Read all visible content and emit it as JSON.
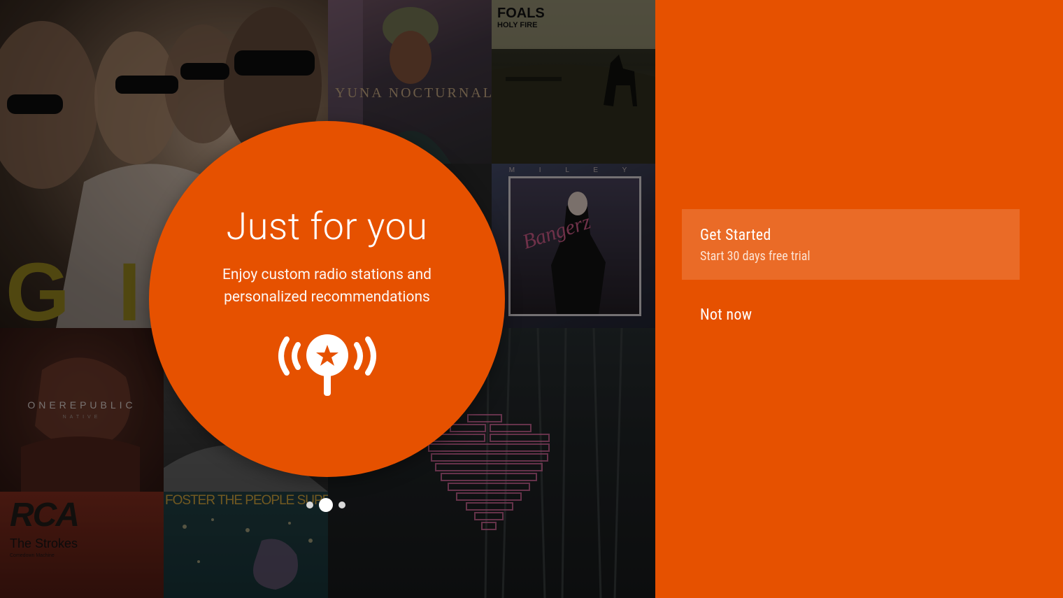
{
  "background": {
    "albums": [
      {
        "id": "pharrell",
        "text": "G I"
      },
      {
        "id": "yuna",
        "text": "YUNA NOCTURNAL"
      },
      {
        "id": "foals",
        "line1": "FOALS",
        "line2": "HOLY FIRE"
      },
      {
        "id": "miley",
        "top_text": "M I L E Y",
        "art_text": "Bangerz"
      },
      {
        "id": "onerepublic",
        "title": "ONEREPUBLIC",
        "subtitle": "NATIVE"
      },
      {
        "id": "rca",
        "label": "RCA",
        "artist": "The Strokes",
        "album": "Comedown Machine"
      },
      {
        "id": "foster",
        "text": "FOSTER THE PEOPLE SUPERMODEL"
      }
    ]
  },
  "promo": {
    "title": "Just for you",
    "description": "Enjoy custom radio stations and personalized recommendations",
    "icon": "radio-station-star-icon",
    "accent_color": "#e65100"
  },
  "pager": {
    "pages": 3,
    "active_index": 1
  },
  "actions": {
    "get_started_label": "Get Started",
    "get_started_sublabel": "Start 30 days free trial",
    "not_now_label": "Not now"
  },
  "colors": {
    "panel": "#e65100",
    "selected_button": "#ea6b27"
  }
}
